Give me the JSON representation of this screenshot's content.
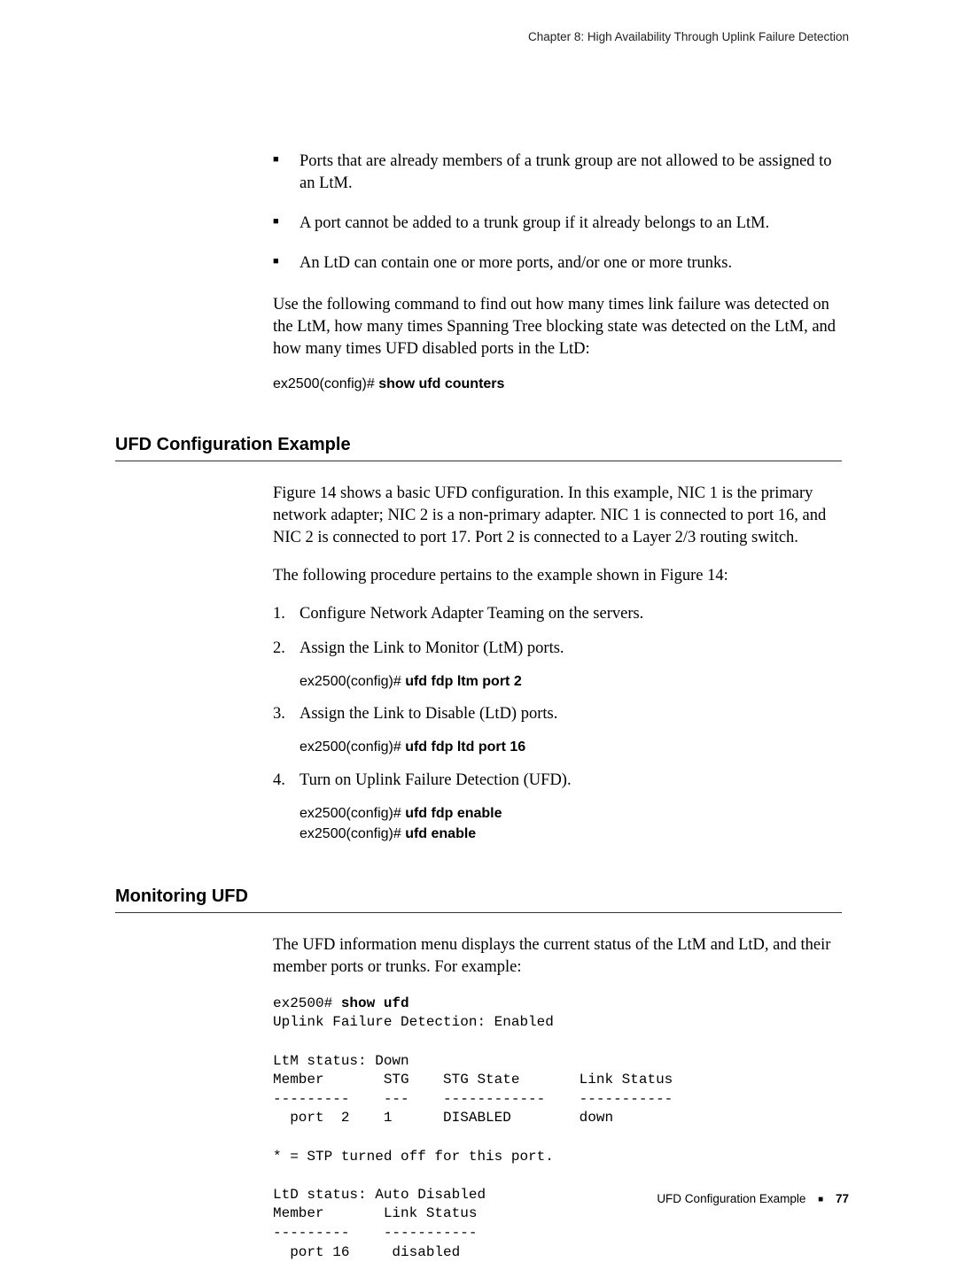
{
  "header": "Chapter 8: High Availability Through Uplink Failure Detection",
  "intro_bullets": [
    "Ports that are already members of a trunk group are not allowed to be assigned to an LtM.",
    "A port cannot be added to a trunk group if it already belongs to an LtM.",
    "An LtD can contain one or more ports, and/or one or more trunks."
  ],
  "intro_para": "Use the following command to find out how many times link failure was detected on the LtM, how many times Spanning Tree blocking state was detected on the LtM, and how many times UFD disabled ports in the LtD:",
  "cmd1": {
    "prompt": "ex2500(config)# ",
    "bold": "show ufd counters"
  },
  "section1": {
    "title": "UFD Configuration Example",
    "para1": "Figure 14 shows a basic UFD configuration. In this example, NIC 1 is the primary network adapter; NIC 2 is a non-primary adapter. NIC 1 is connected to port 16, and NIC 2 is connected to port 17. Port 2 is connected to a Layer 2/3 routing switch.",
    "para2": "The following procedure pertains to the example shown in Figure 14:",
    "steps": [
      {
        "text": "Configure Network Adapter Teaming on the servers."
      },
      {
        "text": "Assign the Link to Monitor (LtM) ports.",
        "cmds": [
          {
            "prompt": "ex2500(config)# ",
            "bold": "ufd fdp ltm port 2"
          }
        ]
      },
      {
        "text": "Assign the Link to Disable (LtD) ports.",
        "cmds": [
          {
            "prompt": "ex2500(config)# ",
            "bold": "ufd fdp ltd port 16"
          }
        ]
      },
      {
        "text": "Turn on Uplink Failure Detection (UFD).",
        "cmds": [
          {
            "prompt": "ex2500(config)# ",
            "bold": "ufd fdp enable"
          },
          {
            "prompt": "ex2500(config)# ",
            "bold": "ufd enable"
          }
        ]
      }
    ]
  },
  "section2": {
    "title": "Monitoring UFD",
    "para": "The UFD information menu displays the current status of the LtM and LtD, and their member ports or trunks. For example:",
    "output_prompt": "ex2500# ",
    "output_cmd": "show ufd",
    "output_body": "Uplink Failure Detection: Enabled\n\nLtM status: Down\nMember       STG    STG State       Link Status\n---------    ---    ------------    -----------\n  port  2    1      DISABLED        down\n\n* = STP turned off for this port.\n\nLtD status: Auto Disabled\nMember       Link Status\n---------    -----------\n  port 16     disabled"
  },
  "footer": {
    "label": "UFD Configuration Example",
    "page": "77"
  }
}
